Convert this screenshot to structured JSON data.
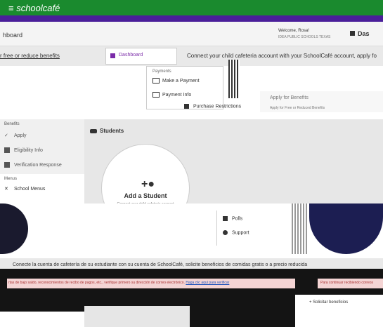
{
  "header": {
    "brand": "≡ schoolcafé",
    "page_title": "hboard",
    "welcome": "Welcome, Rosa!",
    "welcome_sub": "IDEA PUBLIC SCHOOLS TEXAS",
    "dashboard_right": "Das"
  },
  "banner": {
    "left_text": "r free or reduce benefits",
    "right_text": "Connect your child cafeteria account with your SchoolCafé account, apply fo"
  },
  "dashboard_tab": {
    "label": "Dashboard"
  },
  "dropdown": {
    "header": "Payments",
    "items": [
      "Make a Payment",
      "Payment Info"
    ]
  },
  "apply_row": {
    "title": "Apply for Benefits",
    "subtitle": "Apply for Free or Reduced Benefits"
  },
  "purchase": {
    "label": "Purchase Restrictions"
  },
  "sidebar": {
    "benefits_label": "Benefits",
    "items": [
      "Apply",
      "Eligibility Info",
      "Verification Response"
    ],
    "menus_label": "Menus",
    "menus_items": [
      "School Menus"
    ]
  },
  "students": {
    "title": "Students",
    "add_label": "Add a Student",
    "add_sub": "Connect your child cafeteria account"
  },
  "polls_menu": {
    "items": [
      "Polls",
      "Support"
    ]
  },
  "spanish_banner": "Conecte la cuenta de cafetería de su estudiante con su cuenta de SchoolCafé, solicite beneficios de comidas gratis o a precio reducida",
  "alert": {
    "text": "rtas de bajo saldo, reconocimientos de recibo de pagos, etc., verifique primero su dirección de correo electrónico.",
    "link": "Haga clic aquí para verificar",
    "right": "Para continuar recibiendo correos"
  },
  "lower_right": {
    "text": "+ Solicitar beneficios"
  },
  "colors": {
    "topbar_green": "#1a8a2e",
    "topbar_purple": "#4a1f9a",
    "accent_purple": "#7a2aa8",
    "navy": "#1c1e52",
    "alert_pink": "#f4d4d4"
  }
}
